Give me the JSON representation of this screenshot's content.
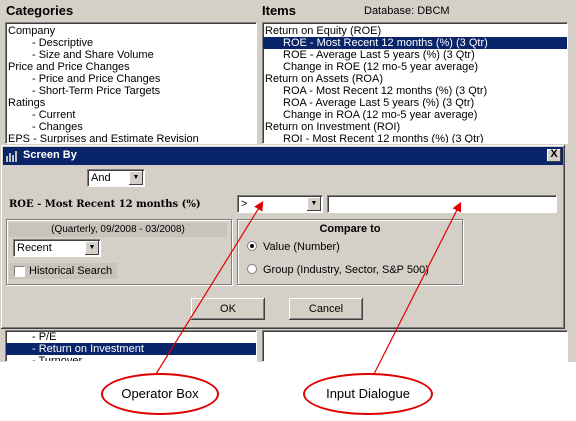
{
  "background": {
    "categories_label": "Categories",
    "items_label": "Items",
    "database_label": "Database: DBCM",
    "categories": [
      {
        "label": "Company",
        "level": 0,
        "selected": false
      },
      {
        "label": "- Descriptive",
        "level": 1,
        "selected": false
      },
      {
        "label": "- Size and Share Volume",
        "level": 1,
        "selected": false
      },
      {
        "label": "Price and Price Changes",
        "level": 0,
        "selected": false
      },
      {
        "label": "- Price and Price Changes",
        "level": 1,
        "selected": false
      },
      {
        "label": "- Short-Term Price Targets",
        "level": 1,
        "selected": false
      },
      {
        "label": "Ratings",
        "level": 0,
        "selected": false
      },
      {
        "label": "- Current",
        "level": 1,
        "selected": false
      },
      {
        "label": "- Changes",
        "level": 1,
        "selected": false
      },
      {
        "label": "EPS - Surprises and Estimate Revision",
        "level": 0,
        "selected": false
      }
    ],
    "categories_bottom": [
      {
        "label": "- P/E",
        "level": 1,
        "selected": false
      },
      {
        "label": "- Return on Investment",
        "level": 1,
        "selected": true
      },
      {
        "label": "- Turnover",
        "level": 1,
        "selected": false
      }
    ],
    "items": [
      {
        "label": "Return on Equity (ROE)",
        "level": 0,
        "selected": false
      },
      {
        "label": "ROE - Most Recent 12 months (%)  (3 Qtr)",
        "level": 1,
        "selected": true
      },
      {
        "label": "ROE - Average Last 5 years (%)  (3 Qtr)",
        "level": 1,
        "selected": false
      },
      {
        "label": "Change in ROE (12 mo-5 year average)",
        "level": 1,
        "selected": false
      },
      {
        "label": "Return on Assets (ROA)",
        "level": 0,
        "selected": false
      },
      {
        "label": "ROA - Most Recent 12 months (%)  (3 Qtr)",
        "level": 1,
        "selected": false
      },
      {
        "label": "ROA - Average Last 5 years (%)  (3 Qtr)",
        "level": 1,
        "selected": false
      },
      {
        "label": "Change in ROA (12 mo-5 year average)",
        "level": 1,
        "selected": false
      },
      {
        "label": "Return on Investment (ROI)",
        "level": 0,
        "selected": false
      },
      {
        "label": "ROI - Most Recent 12 months (%)  (3 Qtr)",
        "level": 1,
        "selected": false
      }
    ]
  },
  "dialog": {
    "title": "Screen By",
    "close_glyph": "X",
    "connector_value": "And",
    "field_name": "ROE - Most Recent 12 months (%)",
    "operator_value": ">",
    "input_value": "",
    "period_label": "(Quarterly, 09/2008 - 03/2008)",
    "period_value": "Recent",
    "historical_label": "Historical Search",
    "historical_checked": false,
    "compare_title": "Compare to",
    "compare_options": [
      {
        "label": "Value (Number)",
        "selected": true
      },
      {
        "label": "Group (Industry, Sector, S&P 500)",
        "selected": false
      }
    ],
    "ok_label": "OK",
    "cancel_label": "Cancel"
  },
  "annotations": {
    "operator_callout": "Operator Box",
    "input_callout": "Input Dialogue",
    "arrow_color": "#e00000"
  },
  "colors": {
    "selection": "#0a246a",
    "title_bar": "#0a246a",
    "window_face": "#d4d0c8"
  }
}
